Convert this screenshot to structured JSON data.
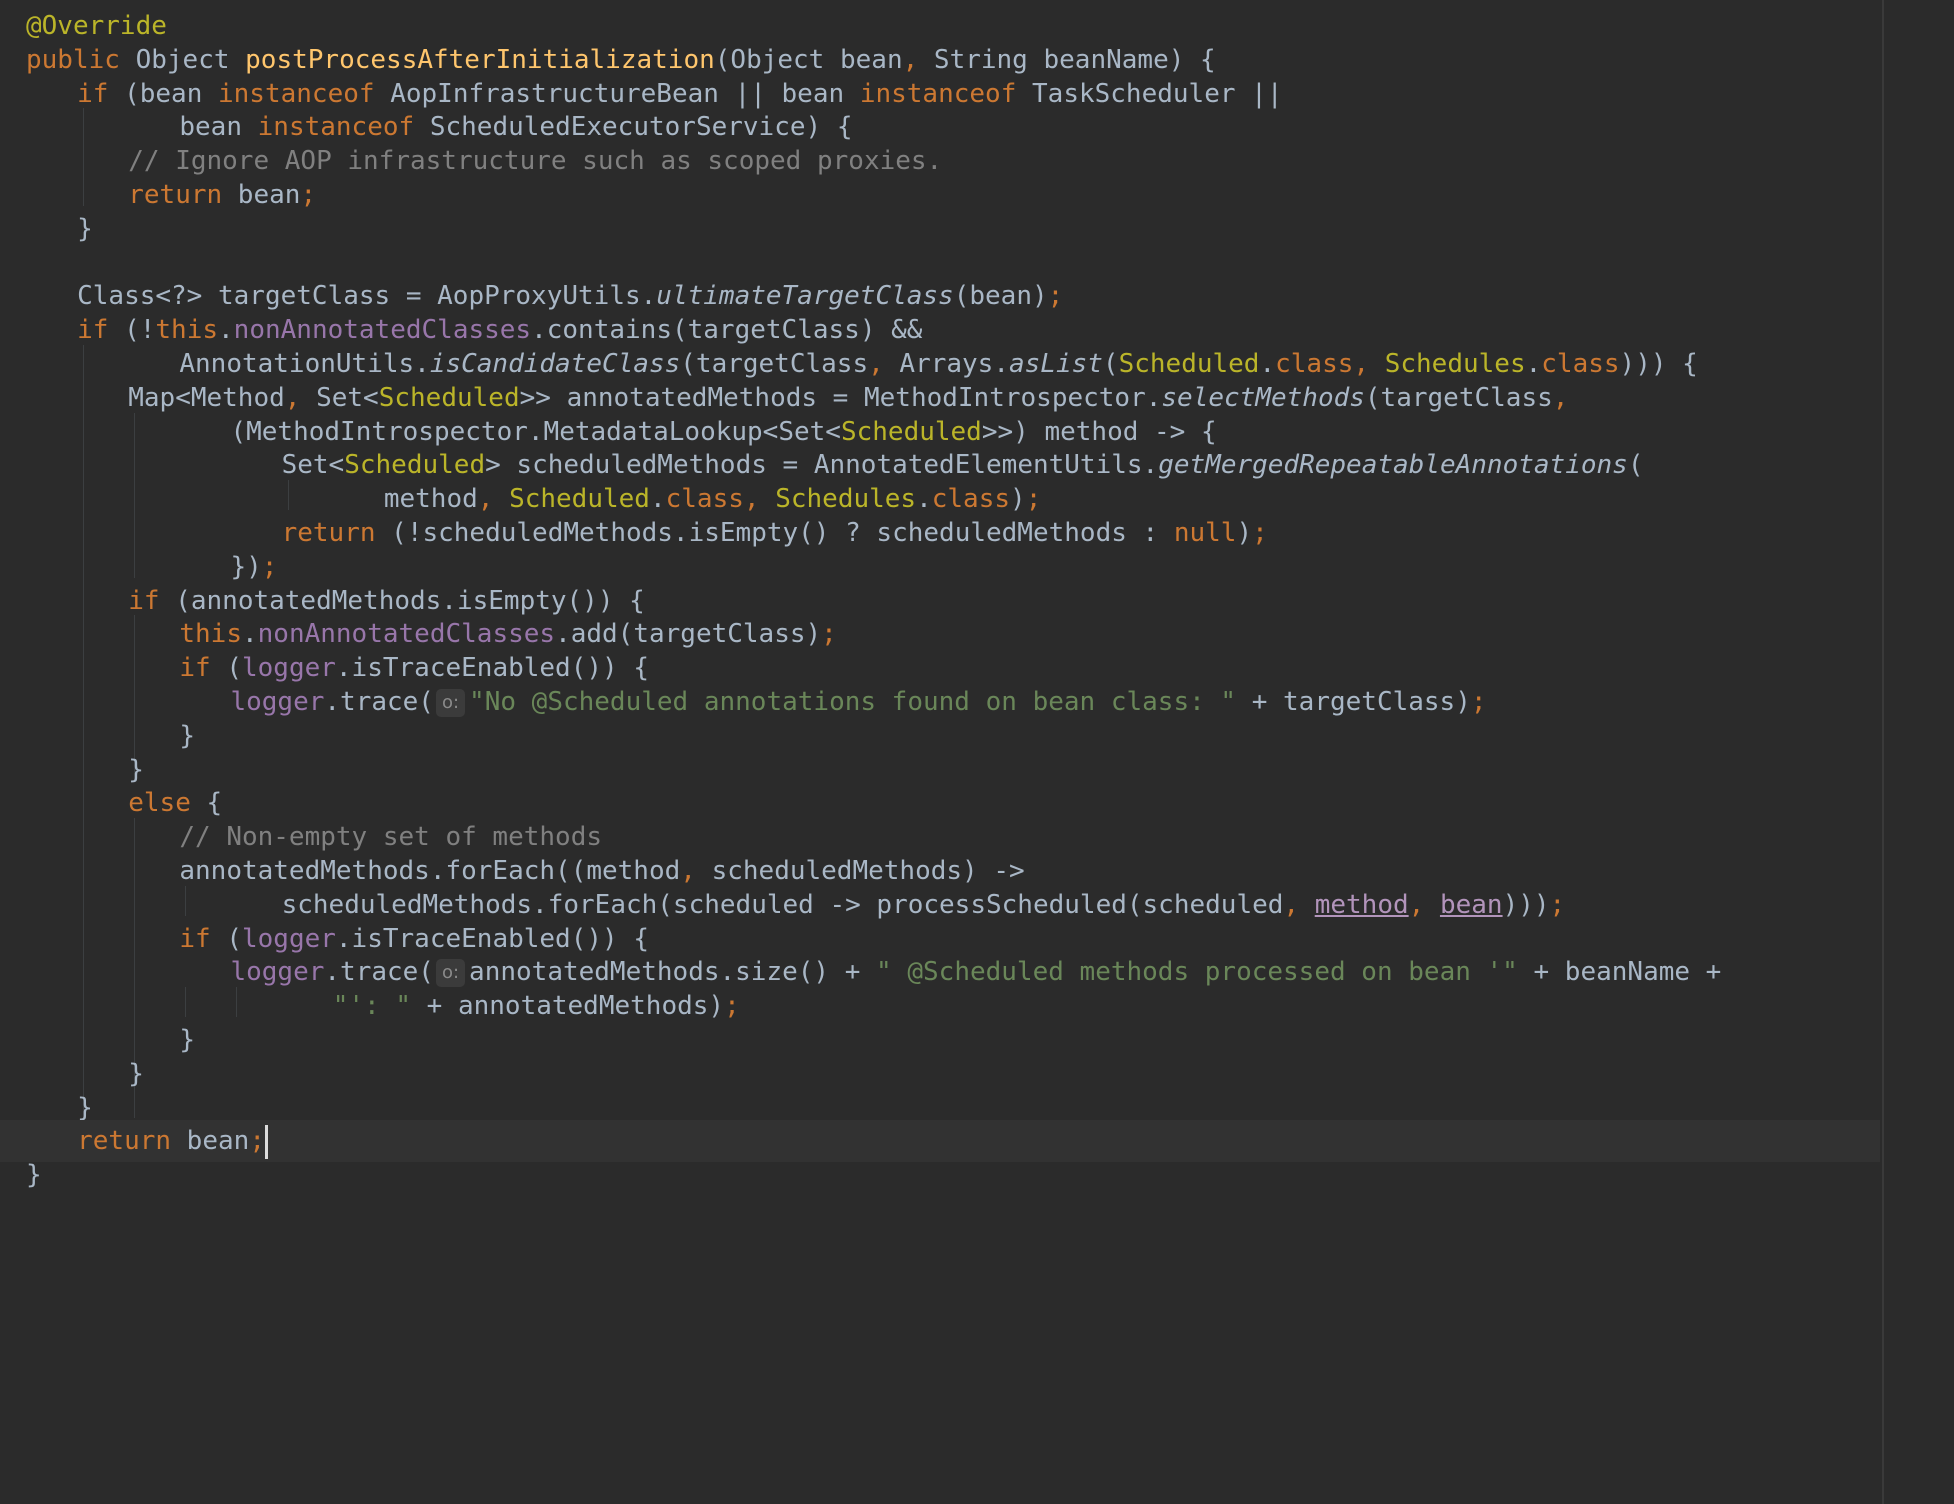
{
  "editor": {
    "language": "java",
    "colors": {
      "background": "#2b2b2b",
      "keyword": "#cc7832",
      "annotation": "#bbb529",
      "method_declaration": "#ffc66d",
      "field": "#9876aa",
      "string": "#6a8759",
      "comment": "#808080",
      "plain": "#a9b7c6"
    },
    "current_line_index": 33,
    "lines": [
      {
        "indent": 0,
        "tokens": [
          {
            "t": "@Override",
            "c": "annotation"
          }
        ]
      },
      {
        "indent": 0,
        "tokens": [
          {
            "t": "public",
            "c": "kw"
          },
          {
            "t": " Object ",
            "c": "plain"
          },
          {
            "t": "postProcessAfterInitialization",
            "c": "method"
          },
          {
            "t": "(Object bean",
            "c": "plain"
          },
          {
            "t": ",",
            "c": "kw"
          },
          {
            "t": " String beanName) {",
            "c": "plain"
          }
        ]
      },
      {
        "indent": 4,
        "tokens": [
          {
            "t": "if",
            "c": "kw"
          },
          {
            "t": " (bean ",
            "c": "plain"
          },
          {
            "t": "instanceof",
            "c": "kw"
          },
          {
            "t": " AopInfrastructureBean || bean ",
            "c": "plain"
          },
          {
            "t": "instanceof",
            "c": "kw"
          },
          {
            "t": " TaskScheduler ||",
            "c": "plain"
          }
        ]
      },
      {
        "indent": 12,
        "tokens": [
          {
            "t": "bean ",
            "c": "plain"
          },
          {
            "t": "instanceof",
            "c": "kw"
          },
          {
            "t": " ScheduledExecutorService) {",
            "c": "plain"
          }
        ]
      },
      {
        "indent": 8,
        "tokens": [
          {
            "t": "// Ignore AOP infrastructure such as scoped proxies.",
            "c": "comment"
          }
        ]
      },
      {
        "indent": 8,
        "tokens": [
          {
            "t": "return",
            "c": "kw"
          },
          {
            "t": " bean",
            "c": "plain"
          },
          {
            "t": ";",
            "c": "kw"
          }
        ]
      },
      {
        "indent": 4,
        "tokens": [
          {
            "t": "}",
            "c": "plain"
          }
        ]
      },
      {
        "indent": 0,
        "tokens": []
      },
      {
        "indent": 4,
        "tokens": [
          {
            "t": "Class<?> targetClass = AopProxyUtils.",
            "c": "plain"
          },
          {
            "t": "ultimateTargetClass",
            "c": "static"
          },
          {
            "t": "(bean)",
            "c": "plain"
          },
          {
            "t": ";",
            "c": "kw"
          }
        ]
      },
      {
        "indent": 4,
        "tokens": [
          {
            "t": "if",
            "c": "kw"
          },
          {
            "t": " (!",
            "c": "plain"
          },
          {
            "t": "this",
            "c": "kw"
          },
          {
            "t": ".",
            "c": "plain"
          },
          {
            "t": "nonAnnotatedClasses",
            "c": "field"
          },
          {
            "t": ".contains(targetClass) &&",
            "c": "plain"
          }
        ]
      },
      {
        "indent": 12,
        "tokens": [
          {
            "t": "AnnotationUtils.",
            "c": "plain"
          },
          {
            "t": "isCandidateClass",
            "c": "static"
          },
          {
            "t": "(targetClass",
            "c": "plain"
          },
          {
            "t": ",",
            "c": "kw"
          },
          {
            "t": " Arrays.",
            "c": "plain"
          },
          {
            "t": "asList",
            "c": "static"
          },
          {
            "t": "(",
            "c": "plain"
          },
          {
            "t": "Scheduled",
            "c": "type"
          },
          {
            "t": ".",
            "c": "plain"
          },
          {
            "t": "class",
            "c": "kw"
          },
          {
            "t": ", ",
            "c": "kw"
          },
          {
            "t": "Schedules",
            "c": "type"
          },
          {
            "t": ".",
            "c": "plain"
          },
          {
            "t": "class",
            "c": "kw"
          },
          {
            "t": "))) {",
            "c": "plain"
          }
        ]
      },
      {
        "indent": 8,
        "tokens": [
          {
            "t": "Map<Method",
            "c": "plain"
          },
          {
            "t": ",",
            "c": "kw"
          },
          {
            "t": " Set<",
            "c": "plain"
          },
          {
            "t": "Scheduled",
            "c": "type"
          },
          {
            "t": ">> annotatedMethods = MethodIntrospector.",
            "c": "plain"
          },
          {
            "t": "selectMethods",
            "c": "static"
          },
          {
            "t": "(targetClass",
            "c": "plain"
          },
          {
            "t": ",",
            "c": "kw"
          }
        ]
      },
      {
        "indent": 16,
        "tokens": [
          {
            "t": "(MethodIntrospector.MetadataLookup<Set<",
            "c": "plain"
          },
          {
            "t": "Scheduled",
            "c": "type"
          },
          {
            "t": ">>) method -> {",
            "c": "plain"
          }
        ]
      },
      {
        "indent": 20,
        "tokens": [
          {
            "t": "Set<",
            "c": "plain"
          },
          {
            "t": "Scheduled",
            "c": "type"
          },
          {
            "t": "> scheduledMethods = AnnotatedElementUtils.",
            "c": "plain"
          },
          {
            "t": "getMergedRepeatableAnnotations",
            "c": "static"
          },
          {
            "t": "(",
            "c": "plain"
          }
        ]
      },
      {
        "indent": 28,
        "tokens": [
          {
            "t": "method",
            "c": "plain"
          },
          {
            "t": ", ",
            "c": "kw"
          },
          {
            "t": "Scheduled",
            "c": "type"
          },
          {
            "t": ".",
            "c": "plain"
          },
          {
            "t": "class",
            "c": "kw"
          },
          {
            "t": ", ",
            "c": "kw"
          },
          {
            "t": "Schedules",
            "c": "type"
          },
          {
            "t": ".",
            "c": "plain"
          },
          {
            "t": "class",
            "c": "kw"
          },
          {
            "t": ")",
            "c": "plain"
          },
          {
            "t": ";",
            "c": "kw"
          }
        ]
      },
      {
        "indent": 20,
        "tokens": [
          {
            "t": "return",
            "c": "kw"
          },
          {
            "t": " (!scheduledMethods.isEmpty() ? scheduledMethods : ",
            "c": "plain"
          },
          {
            "t": "null",
            "c": "kw"
          },
          {
            "t": ")",
            "c": "plain"
          },
          {
            "t": ";",
            "c": "kw"
          }
        ]
      },
      {
        "indent": 16,
        "tokens": [
          {
            "t": "})",
            "c": "plain"
          },
          {
            "t": ";",
            "c": "kw"
          }
        ]
      },
      {
        "indent": 8,
        "tokens": [
          {
            "t": "if",
            "c": "kw"
          },
          {
            "t": " (annotatedMethods.isEmpty()) {",
            "c": "plain"
          }
        ]
      },
      {
        "indent": 12,
        "tokens": [
          {
            "t": "this",
            "c": "kw"
          },
          {
            "t": ".",
            "c": "plain"
          },
          {
            "t": "nonAnnotatedClasses",
            "c": "field"
          },
          {
            "t": ".add(targetClass)",
            "c": "plain"
          },
          {
            "t": ";",
            "c": "kw"
          }
        ]
      },
      {
        "indent": 12,
        "tokens": [
          {
            "t": "if",
            "c": "kw"
          },
          {
            "t": " (",
            "c": "plain"
          },
          {
            "t": "logger",
            "c": "field"
          },
          {
            "t": ".isTraceEnabled()) {",
            "c": "plain"
          }
        ]
      },
      {
        "indent": 16,
        "tokens": [
          {
            "t": "logger",
            "c": "field"
          },
          {
            "t": ".trace(",
            "c": "plain"
          },
          {
            "t": "o:",
            "c": "hint"
          },
          {
            "t": "\"No @Scheduled annotations found on bean class: \"",
            "c": "string"
          },
          {
            "t": " + targetClass)",
            "c": "plain"
          },
          {
            "t": ";",
            "c": "kw"
          }
        ]
      },
      {
        "indent": 12,
        "tokens": [
          {
            "t": "}",
            "c": "plain"
          }
        ]
      },
      {
        "indent": 8,
        "tokens": [
          {
            "t": "}",
            "c": "plain"
          }
        ]
      },
      {
        "indent": 8,
        "tokens": [
          {
            "t": "else",
            "c": "kw"
          },
          {
            "t": " {",
            "c": "plain"
          }
        ]
      },
      {
        "indent": 12,
        "tokens": [
          {
            "t": "// Non-empty set of methods",
            "c": "comment"
          }
        ]
      },
      {
        "indent": 12,
        "tokens": [
          {
            "t": "annotatedMethods.forEach((method",
            "c": "plain"
          },
          {
            "t": ",",
            "c": "kw"
          },
          {
            "t": " scheduledMethods) ->",
            "c": "plain"
          }
        ]
      },
      {
        "indent": 20,
        "tokens": [
          {
            "t": "scheduledMethods.forEach(scheduled -> processScheduled(scheduled",
            "c": "plain"
          },
          {
            "t": ", ",
            "c": "kw"
          },
          {
            "t": "method",
            "c": "ul"
          },
          {
            "t": ", ",
            "c": "kw"
          },
          {
            "t": "bean",
            "c": "ul"
          },
          {
            "t": ")))",
            "c": "plain"
          },
          {
            "t": ";",
            "c": "kw"
          }
        ]
      },
      {
        "indent": 12,
        "tokens": [
          {
            "t": "if",
            "c": "kw"
          },
          {
            "t": " (",
            "c": "plain"
          },
          {
            "t": "logger",
            "c": "field"
          },
          {
            "t": ".isTraceEnabled()) {",
            "c": "plain"
          }
        ]
      },
      {
        "indent": 16,
        "tokens": [
          {
            "t": "logger",
            "c": "field"
          },
          {
            "t": ".trace(",
            "c": "plain"
          },
          {
            "t": "o:",
            "c": "hint"
          },
          {
            "t": "annotatedMethods.size() + ",
            "c": "plain"
          },
          {
            "t": "\" @Scheduled methods processed on bean '\"",
            "c": "string"
          },
          {
            "t": " + beanName +",
            "c": "plain"
          }
        ]
      },
      {
        "indent": 24,
        "tokens": [
          {
            "t": "\"': \"",
            "c": "string"
          },
          {
            "t": " + annotatedMethods)",
            "c": "plain"
          },
          {
            "t": ";",
            "c": "kw"
          }
        ]
      },
      {
        "indent": 12,
        "tokens": [
          {
            "t": "}",
            "c": "plain"
          }
        ]
      },
      {
        "indent": 8,
        "tokens": [
          {
            "t": "}",
            "c": "plain"
          }
        ]
      },
      {
        "indent": 4,
        "tokens": [
          {
            "t": "}",
            "c": "plain"
          }
        ]
      },
      {
        "indent": 4,
        "tokens": [
          {
            "t": "return",
            "c": "kw"
          },
          {
            "t": " bean",
            "c": "plain"
          },
          {
            "t": ";",
            "c": "kw"
          }
        ]
      },
      {
        "indent": 0,
        "tokens": [
          {
            "t": "}",
            "c": "plain"
          }
        ]
      }
    ]
  }
}
